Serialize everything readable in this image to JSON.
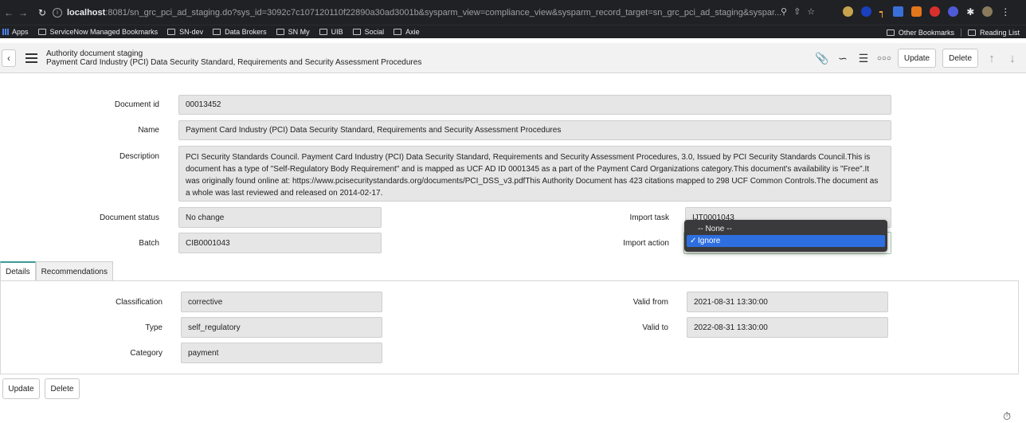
{
  "browser": {
    "url_host": "localhost",
    "url_rest": ":8081/sn_grc_pci_ad_staging.do?sys_id=3092c7c107120110f22890a30ad3001b&sysparm_view=compliance_view&sysparm_record_target=sn_grc_pci_ad_staging&syspar...",
    "bookmarks": [
      "Apps",
      "ServiceNow Managed Bookmarks",
      "SN-dev",
      "Data Brokers",
      "SN My",
      "UIB",
      "Social",
      "Axie"
    ],
    "other_bookmarks": "Other Bookmarks",
    "reading_list": "Reading List"
  },
  "header": {
    "table_title": "Authority document staging",
    "record_title": "Payment Card Industry (PCI) Data Security Standard, Requirements and Security Assessment Procedures",
    "update_label": "Update",
    "delete_label": "Delete"
  },
  "form": {
    "document_id": {
      "label": "Document id",
      "value": "00013452"
    },
    "name": {
      "label": "Name",
      "value": "Payment Card Industry (PCI) Data Security Standard, Requirements and Security Assessment Procedures"
    },
    "description": {
      "label": "Description",
      "value": "PCI Security Standards Council. Payment Card Industry (PCI) Data Security Standard, Requirements and Security Assessment Procedures, 3.0, Issued by PCI Security Standards Council.This is document has a type of \"Self-Regulatory Body Requirement\" and is mapped as UCF AD ID 0001345 as a part of the Payment Card Organizations category.This document's availability is \"Free\".It was originally found online at: https://www.pcisecuritystandards.org/documents/PCI_DSS_v3.pdfThis Authority Document has 423 citations mapped to 298 UCF Common Controls.The document as a whole was last reviewed and released on 2014-02-17."
    },
    "document_status": {
      "label": "Document status",
      "value": "No change"
    },
    "batch": {
      "label": "Batch",
      "value": "CIB0001043"
    },
    "import_task": {
      "label": "Import task",
      "value": "IJT0001043"
    },
    "import_action": {
      "label": "Import action",
      "options": [
        "-- None --",
        "Ignore"
      ],
      "selected": "Ignore"
    }
  },
  "tabs": [
    {
      "label": "Details",
      "active": true
    },
    {
      "label": "Recommendations",
      "active": false
    }
  ],
  "details": {
    "classification": {
      "label": "Classification",
      "value": "corrective"
    },
    "type": {
      "label": "Type",
      "value": "self_regulatory"
    },
    "category": {
      "label": "Category",
      "value": "payment"
    },
    "valid_from": {
      "label": "Valid from",
      "value": "2021-08-31 13:30:00"
    },
    "valid_to": {
      "label": "Valid to",
      "value": "2022-08-31 13:30:00"
    }
  },
  "footer": {
    "update_label": "Update",
    "delete_label": "Delete"
  }
}
